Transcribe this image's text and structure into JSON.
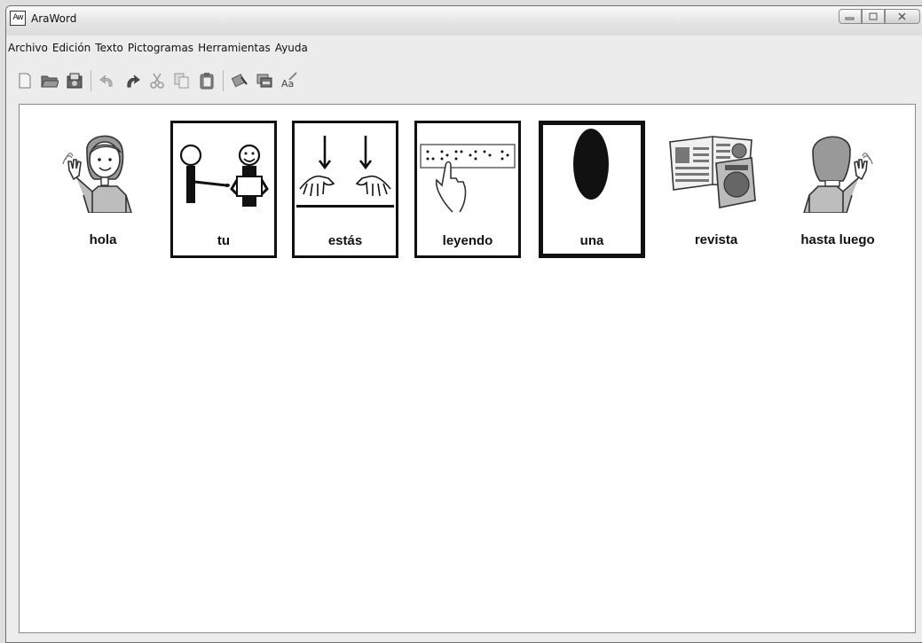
{
  "window": {
    "title": "AraWord",
    "icon_text": "Aw"
  },
  "menu": [
    "Archivo",
    "Edición",
    "Texto",
    "Pictogramas",
    "Herramientas",
    "Ayuda"
  ],
  "toolbar_icons": [
    "new-document-icon",
    "open-folder-icon",
    "save-icon",
    "undo-icon",
    "redo-icon",
    "cut-icon",
    "copy-icon",
    "paste-icon",
    "pictogram-icon",
    "image-icon",
    "text-format-icon"
  ],
  "document": {
    "pictograms": [
      {
        "word": "hola",
        "framed": false
      },
      {
        "word": "tu",
        "framed": true
      },
      {
        "word": "estás",
        "framed": true
      },
      {
        "word": "leyendo",
        "framed": true
      },
      {
        "word": "una",
        "framed": true
      },
      {
        "word": "revista",
        "framed": false
      },
      {
        "word": "hasta luego",
        "framed": false
      }
    ]
  },
  "colors": {
    "window_bg": "#ececec",
    "document_bg": "#ffffff",
    "frame": "#111111"
  }
}
